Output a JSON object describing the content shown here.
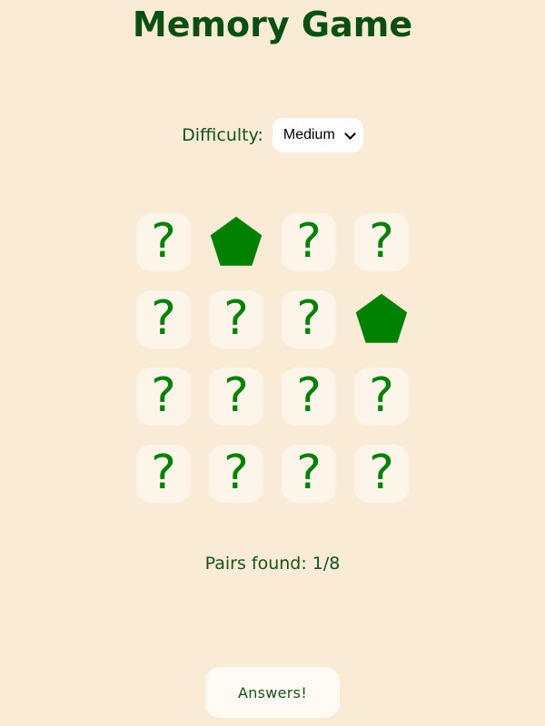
{
  "title": "Memory Game",
  "difficulty": {
    "label": "Difficulty:",
    "selected": "Medium"
  },
  "board": {
    "hidden_symbol": "?",
    "cards": [
      {
        "state": "hidden"
      },
      {
        "state": "revealed",
        "shape": "pentagon-icon"
      },
      {
        "state": "hidden"
      },
      {
        "state": "hidden"
      },
      {
        "state": "hidden"
      },
      {
        "state": "hidden"
      },
      {
        "state": "hidden"
      },
      {
        "state": "revealed",
        "shape": "pentagon-icon"
      },
      {
        "state": "hidden"
      },
      {
        "state": "hidden"
      },
      {
        "state": "hidden"
      },
      {
        "state": "hidden"
      },
      {
        "state": "hidden"
      },
      {
        "state": "hidden"
      },
      {
        "state": "hidden"
      },
      {
        "state": "hidden"
      }
    ]
  },
  "status": {
    "pairs_found": "Pairs found: 1/8"
  },
  "answers_button": {
    "label": "Answers!"
  },
  "colors": {
    "background": "#faebd7",
    "accent_green": "#008000",
    "title_green": "#0b4f10",
    "card_face": "#fdf4ea"
  }
}
